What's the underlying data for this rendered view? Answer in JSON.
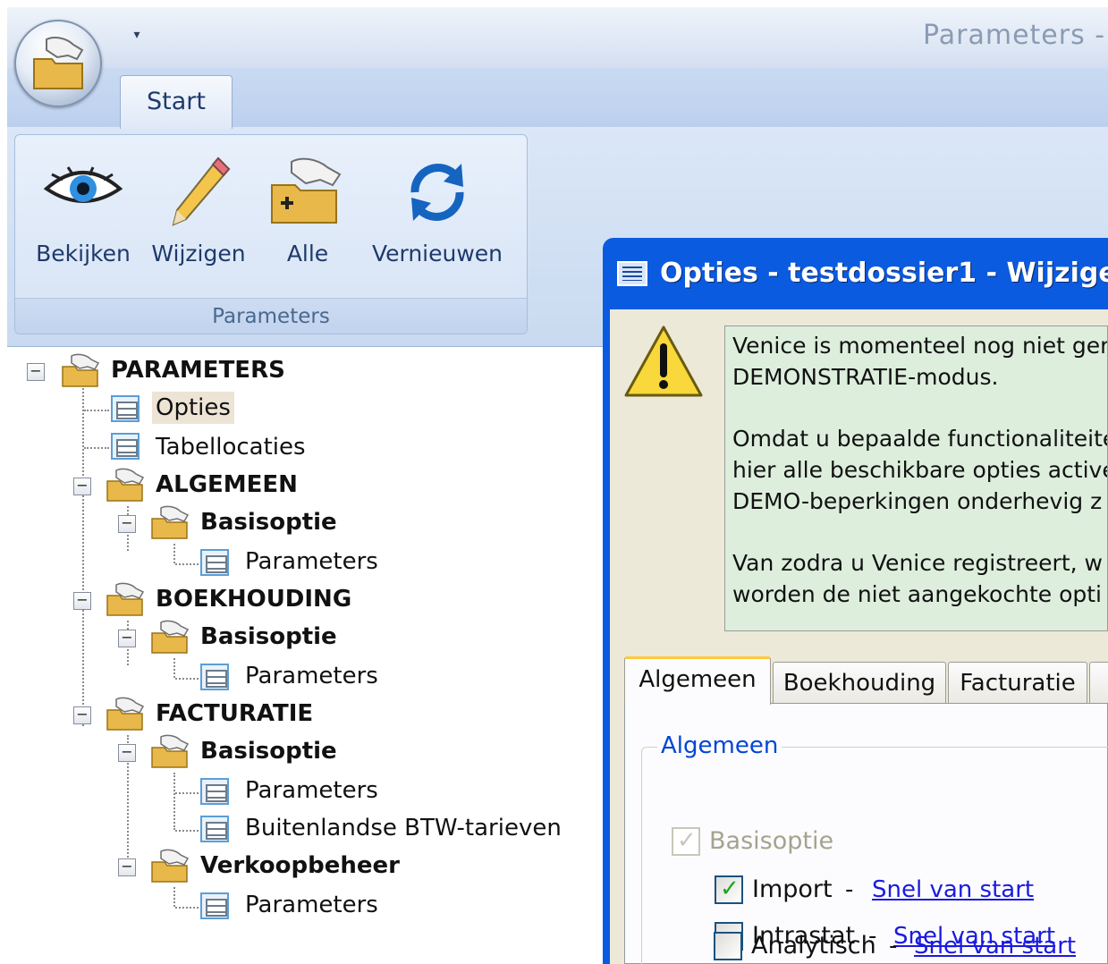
{
  "window": {
    "title": "Parameters -"
  },
  "ribbon": {
    "tabs": [
      {
        "label": "Start"
      }
    ],
    "group_label": "Parameters",
    "buttons": [
      {
        "label": "Bekijken",
        "icon": "eye-icon"
      },
      {
        "label": "Wijzigen",
        "icon": "pencil-icon"
      },
      {
        "label": "Alle",
        "icon": "add-folder-icon"
      },
      {
        "label": "Vernieuwen",
        "icon": "refresh-icon"
      }
    ]
  },
  "tree": {
    "root": "PARAMETERS",
    "items": {
      "opties": "Opties",
      "tabellocaties": "Tabellocaties",
      "algemeen": "ALGEMEEN",
      "algemeen_basisoptie": "Basisoptie",
      "algemeen_parameters": "Parameters",
      "boekhouding": "BOEKHOUDING",
      "boekhouding_basisoptie": "Basisoptie",
      "boekhouding_parameters": "Parameters",
      "facturatie": "FACTURATIE",
      "facturatie_basisoptie": "Basisoptie",
      "facturatie_parameters": "Parameters",
      "facturatie_btw": "Buitenlandse BTW-tarieven",
      "verkoopbeheer": "Verkoopbeheer",
      "verkoopbeheer_parameters": "Parameters"
    },
    "selected": "Opties"
  },
  "dialog": {
    "title": "Opties - testdossier1 - Wijzige",
    "info_lines": [
      "Venice is momenteel nog niet ger",
      "DEMONSTRATIE-modus.",
      "Omdat u bepaalde functionaliteite",
      "hier alle beschikbare opties active",
      "DEMO-beperkingen onderhevig z",
      "Van zodra u Venice registreert, w",
      "worden de niet aangekochte opti"
    ],
    "tabs": [
      "Algemeen",
      "Boekhouding",
      "Facturatie"
    ],
    "group_title": "Algemeen",
    "options": [
      {
        "label": "Basisoptie",
        "checked": true,
        "disabled": true
      },
      {
        "label": "Import",
        "checked": true,
        "link": "Snel van start",
        "separator": "-"
      },
      {
        "label": "Intrastat",
        "checked": false,
        "link": "Snel van start",
        "separator": "-"
      },
      {
        "label": "Analytisch",
        "checked": false,
        "link": "Snel van start",
        "separator": "-"
      }
    ]
  },
  "colors": {
    "ribbon": "#c9daf2",
    "dialog_title": "#0a5be0",
    "info_bg": "#ddeedd",
    "link": "#1a1ae0"
  }
}
